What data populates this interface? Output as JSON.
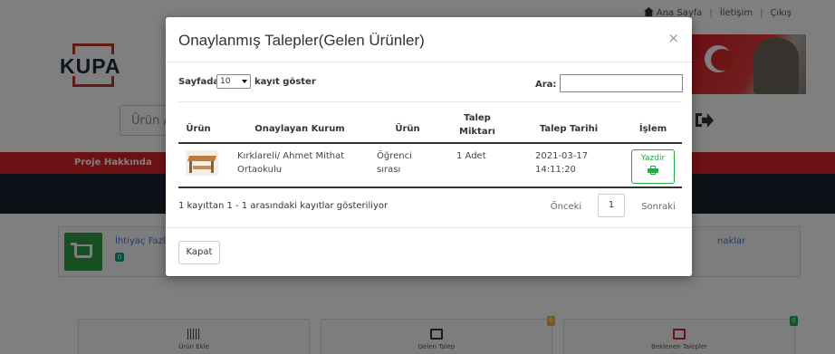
{
  "topbar": {
    "home": "Ana Sayfa",
    "contact": "İletişim",
    "logout": "Çıkış"
  },
  "logo": {
    "text": "KUPA"
  },
  "search": {
    "value": "Ürün A"
  },
  "nav": {
    "about": "Proje Hakkında"
  },
  "panel": {
    "left_link": "İhtiyaç Fazl",
    "left_badge": "0",
    "right_link": "naklar"
  },
  "tiles": [
    {
      "label": "Ürün Ekle"
    },
    {
      "label": "Gelen Talep",
      "badge": "0",
      "badge_color": "#f0ad4e"
    },
    {
      "label": "Beklenen Talepler",
      "badge": "0",
      "badge_color": "#28a745"
    }
  ],
  "modal": {
    "title": "Onaylanmış Talepler(Gelen Ürünler)",
    "close": "×",
    "length_label": "Sayfada",
    "length_value": "10",
    "length_after": "kayıt göster",
    "search_label": "Ara:",
    "search_value": "",
    "columns": [
      "Ürün",
      "Onaylayan Kurum",
      "Ürün",
      "Talep Miktarı",
      "Talep Tarihi",
      "İşlem"
    ],
    "rows": [
      {
        "institution": "Kırklareli/ Ahmet Mithat Ortaokulu",
        "product": "Öğrenci sırası",
        "quantity": "1 Adet",
        "date": "2021-03-17 14:11:20",
        "action": "Yazdir"
      }
    ],
    "info": "1 kayıttan 1 - 1 arasındaki kayıtlar gösteriliyor",
    "prev": "Önceki",
    "page": "1",
    "next": "Sonraki",
    "close_button": "Kapat"
  },
  "colors": {
    "accent_red": "#d9242b",
    "success": "#28a745",
    "link": "#3b7dd8"
  }
}
